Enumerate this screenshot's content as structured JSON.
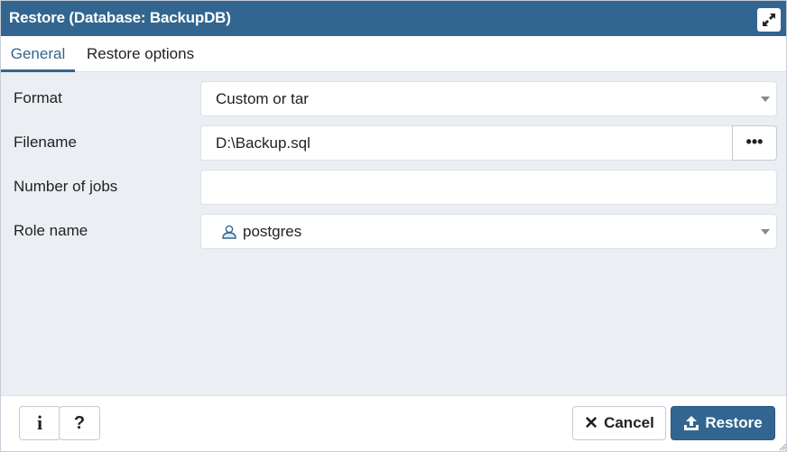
{
  "window": {
    "title": "Restore (Database: BackupDB)",
    "maximize_icon": "expand-icon"
  },
  "tabs": [
    {
      "label": "General",
      "active": true
    },
    {
      "label": "Restore options",
      "active": false
    }
  ],
  "form": {
    "format": {
      "label": "Format",
      "value": "Custom or tar"
    },
    "filename": {
      "label": "Filename",
      "value": "D:\\Backup.sql",
      "browse_label": "•••"
    },
    "jobs": {
      "label": "Number of jobs",
      "value": ""
    },
    "role": {
      "label": "Role name",
      "value": "postgres",
      "icon": "user-icon"
    }
  },
  "footer": {
    "info_label": "i",
    "help_label": "?",
    "cancel_label": "Cancel",
    "restore_label": "Restore"
  },
  "colors": {
    "header": "#326690",
    "background": "#ebeef3",
    "primary_button": "#326690"
  }
}
